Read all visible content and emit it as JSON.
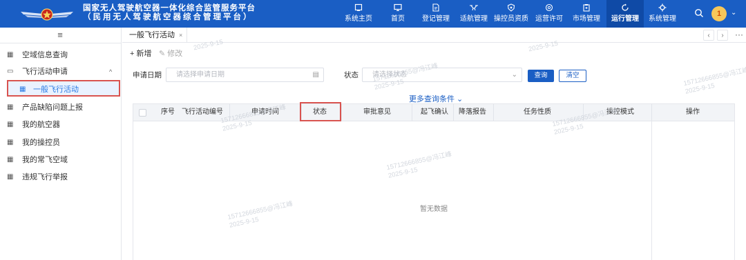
{
  "app": {
    "title_line1": "国家无人驾驶航空器一体化综合监管服务平台",
    "title_line2": "（民用无人驾驶航空器综合管理平台）"
  },
  "nav": [
    {
      "label": "系统主页",
      "icon": "home-panel-icon"
    },
    {
      "label": "首页",
      "icon": "monitor-icon"
    },
    {
      "label": "登记管理",
      "icon": "document-edit-icon"
    },
    {
      "label": "适航管理",
      "icon": "drone-icon"
    },
    {
      "label": "操控员资质",
      "icon": "shield-icon"
    },
    {
      "label": "运营许可",
      "icon": "settings-badge-icon"
    },
    {
      "label": "市场管理",
      "icon": "clipboard-icon"
    },
    {
      "label": "运行管理",
      "icon": "cycle-icon",
      "active": true
    },
    {
      "label": "系统管理",
      "icon": "gear-icon"
    }
  ],
  "user": {
    "avatar_text": "1"
  },
  "sidebar": {
    "items": [
      {
        "label": "空域信息查询"
      },
      {
        "label": "飞行活动申请"
      },
      {
        "label": "一般飞行活动"
      },
      {
        "label": "产品缺陷问题上报"
      },
      {
        "label": "我的航空器"
      },
      {
        "label": "我的操控员"
      },
      {
        "label": "我的常飞空域"
      },
      {
        "label": "违规飞行举报"
      }
    ]
  },
  "tabs": [
    {
      "label": "一般飞行活动",
      "close": "×"
    }
  ],
  "toolbar": {
    "add": "+ 新增",
    "edit": "修改"
  },
  "form": {
    "date_label": "申请日期",
    "date_placeholder": "请选择申请日期",
    "status_label": "状态",
    "status_placeholder": "请选择状态",
    "query": "查询",
    "clear": "清空",
    "more": "更多查询条件"
  },
  "table": {
    "headers": [
      "序号",
      "飞行活动编号",
      "申请时间",
      "状态",
      "审批意见",
      "起飞确认",
      "降落报告",
      "任务性质",
      "操控模式",
      "操作"
    ],
    "empty_text": "暂无数据"
  },
  "watermark": {
    "line1": "15712666855@冯江峰",
    "line2": "2025-9-15"
  },
  "colors": {
    "brand": "#1a5ec4",
    "highlight": "#d9534f"
  }
}
